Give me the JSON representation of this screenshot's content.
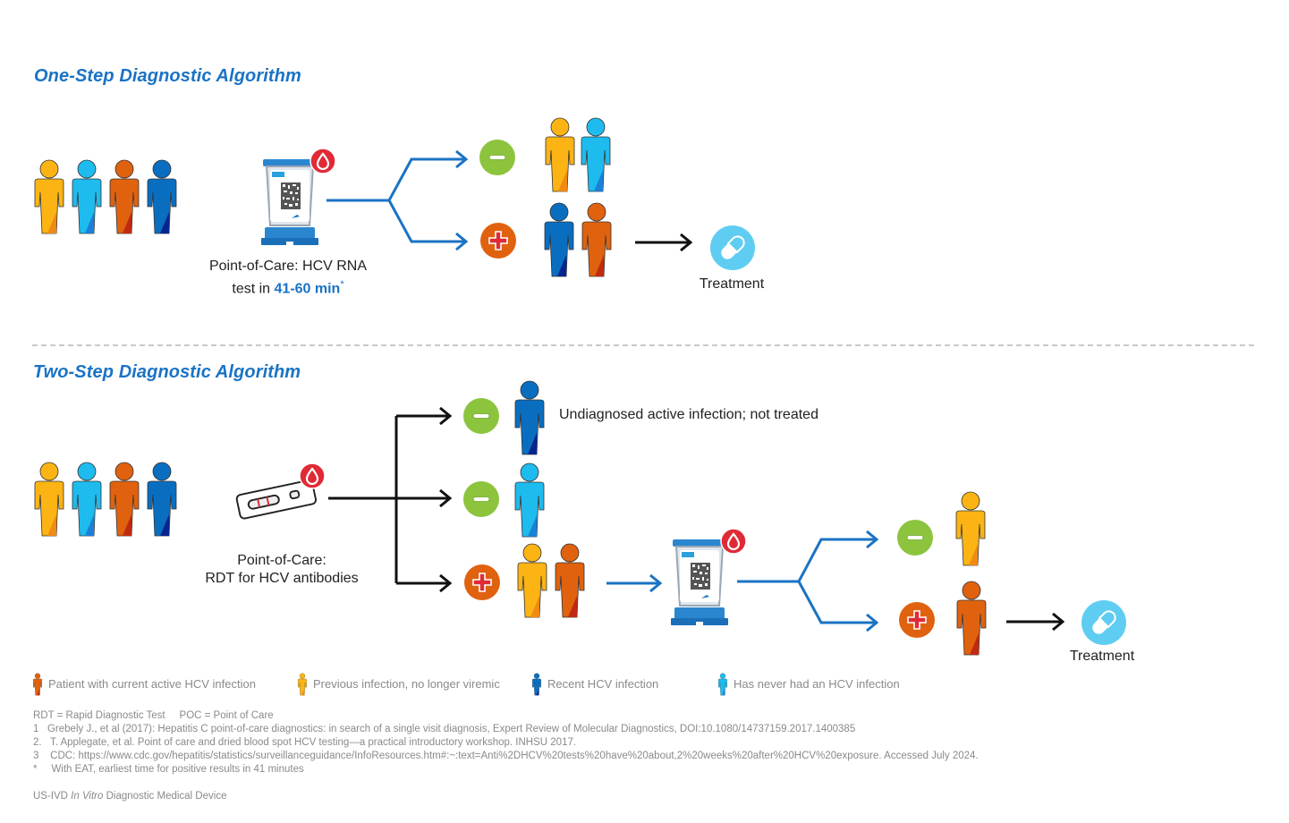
{
  "sections": {
    "one_step": {
      "title": "One-Step Diagnostic Algorithm",
      "test_caption_line1": "Point-of-Care: HCV RNA",
      "test_caption_line2_prefix": "test in ",
      "test_caption_highlight": "41-60 min",
      "test_caption_mark": "*",
      "results": [
        {
          "result": "negative",
          "people": [
            "previous",
            "never"
          ]
        },
        {
          "result": "positive",
          "people": [
            "recent",
            "current"
          ],
          "outcome": "Treatment"
        }
      ]
    },
    "two_step": {
      "title": "Two-Step Diagnostic Algorithm",
      "test_caption_line1": "Point-of-Care:",
      "test_caption_line2": "RDT for HCV antibodies",
      "results": [
        {
          "result": "negative",
          "people": [
            "recent"
          ],
          "note": "Undiagnosed active infection; not treated"
        },
        {
          "result": "negative",
          "people": [
            "never"
          ]
        },
        {
          "result": "positive",
          "people": [
            "previous",
            "current"
          ]
        }
      ],
      "second_test": {
        "results": [
          {
            "result": "negative",
            "people": [
              "previous"
            ]
          },
          {
            "result": "positive",
            "people": [
              "current"
            ],
            "outcome": "Treatment"
          }
        ]
      }
    }
  },
  "population": [
    "previous",
    "never",
    "current",
    "recent"
  ],
  "legend": [
    {
      "key": "current",
      "label": "Patient with current active HCV infection"
    },
    {
      "key": "previous",
      "label": "Previous infection, no longer viremic"
    },
    {
      "key": "recent",
      "label": "Recent HCV infection"
    },
    {
      "key": "never",
      "label": "Has never had an HCV infection"
    }
  ],
  "colors": {
    "previous": "#fbb413",
    "never": "#1ebbee",
    "current": "#e0620f",
    "recent": "#0a6ec0",
    "accent_blue": "#1a73c4",
    "negative_green": "#8cc43e",
    "positive_orange": "#e0620f",
    "blood_red": "#e02a35",
    "treatment_blue": "#5fcdf2"
  },
  "footnotes": {
    "abbrev": "RDT = Rapid Diagnostic Test     POC = Point of Care",
    "refs": [
      "1   Grebely J., et al (2017): Hepatitis C point-of-care diagnostics: in search of a single visit diagnosis, Expert Review of Molecular Diagnostics, DOI:10.1080/14737159.2017.1400385",
      "2.   T. Applegate, et al. Point of care and dried blood spot HCV testing—a practical introductory workshop. INHSU 2017.",
      "3    CDC: https://www.cdc.gov/hepatitis/statistics/surveillanceguidance/InfoResources.htm#:~:text=Anti%2DHCV%20tests%20have%20about,2%20weeks%20after%20HCV%20exposure. Accessed July 2024.",
      "*     With EAT, earliest time for positive results in 41 minutes"
    ],
    "device_prefix": "US-IVD ",
    "device_italic": "In Vitro",
    "device_suffix": " Diagnostic Medical Device"
  }
}
